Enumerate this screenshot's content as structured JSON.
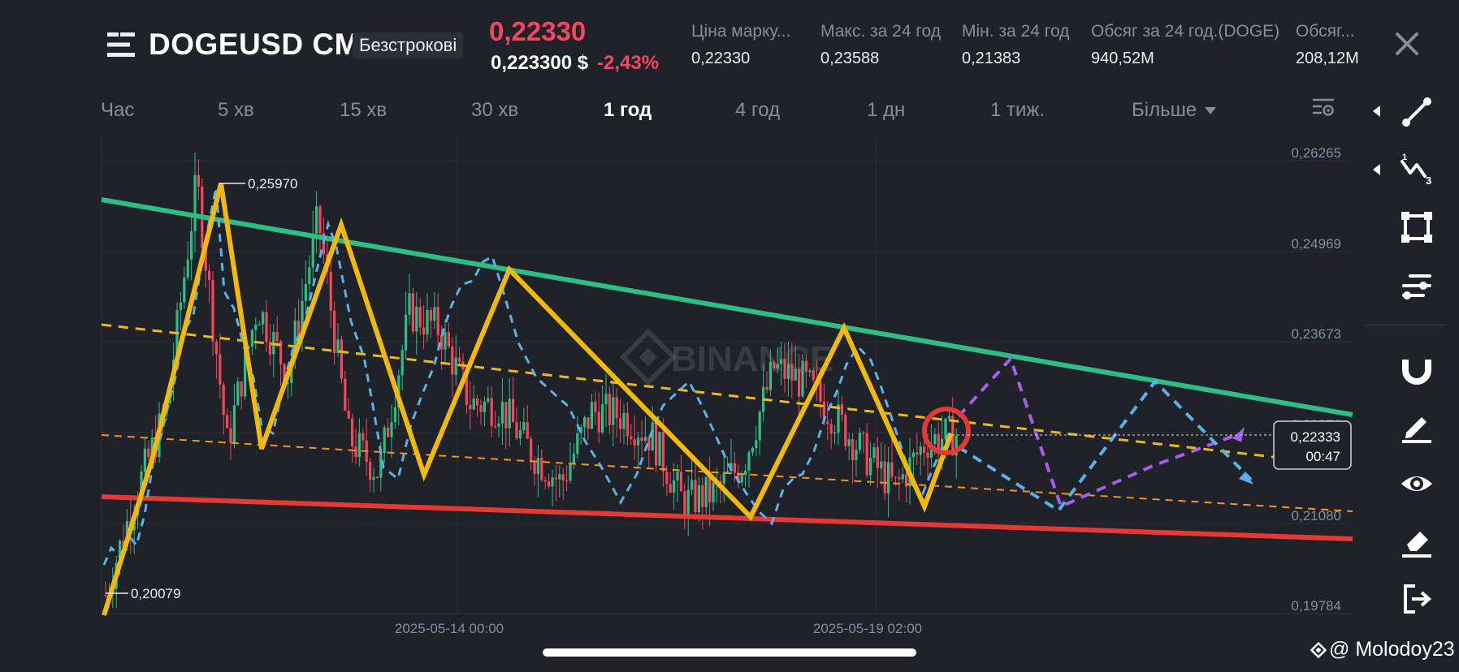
{
  "header": {
    "symbol": "DOGEUSD CM",
    "badge": "Безстрокові",
    "last_price": "0,22330",
    "sub_price": "0,223300 $",
    "change_pct": "-2,43%",
    "stats": [
      {
        "label": "Ціна марку...",
        "value": "0,22330"
      },
      {
        "label": "Макс. за 24 год",
        "value": "0,23588"
      },
      {
        "label": "Мін. за 24 год",
        "value": "0,21383"
      },
      {
        "label": "Обсяг за 24 год.(DOGE)",
        "value": "940,52M"
      },
      {
        "label": "Обсяг...",
        "value": "208,12M"
      }
    ]
  },
  "tabs": [
    {
      "label": "Час",
      "active": false
    },
    {
      "label": "5 хв",
      "active": false
    },
    {
      "label": "15 хв",
      "active": false
    },
    {
      "label": "30 хв",
      "active": false
    },
    {
      "label": "1 год",
      "active": true
    },
    {
      "label": "4 год",
      "active": false
    },
    {
      "label": "1 дн",
      "active": false
    },
    {
      "label": "1 тиж.",
      "active": false
    }
  ],
  "more_label": "Більше",
  "chart": {
    "watermark": "BINANCE",
    "y_ticks": [
      "0,26265",
      "0,24969",
      "0,23673",
      "0,22376",
      "0,21080",
      "0,19784"
    ],
    "x_ticks": [
      "2025-05-14 00:00",
      "2025-05-19 02:00"
    ],
    "high_label": "0,25970",
    "low_label": "0,20079",
    "current_price": "0,22333",
    "countdown": "00:47",
    "colors": {
      "up": "#2ebd85",
      "down": "#f6465d",
      "resistance": "#2ebd85",
      "support": "#e53935",
      "zigzag": "#f0b90b",
      "midline": "#f0b90b",
      "lower_dashed": "#f7931a",
      "projection_blue": "#5ab0e8",
      "projection_purple": "#a55eea",
      "marker_circle": "#e53935"
    }
  },
  "chart_data": {
    "type": "candlestick",
    "symbol": "DOGEUSD CM",
    "interval": "1 год",
    "y_range": [
      0.19784,
      0.26265
    ],
    "y_ticks": [
      0.26265,
      0.24969,
      0.23673,
      0.22376,
      0.2108,
      0.19784
    ],
    "x_ticks": [
      "2025-05-14 00:00",
      "2025-05-19 02:00"
    ],
    "max_marked": 0.2597,
    "min_marked": 0.20079,
    "last_price": 0.22333,
    "price_path": [
      0.2005,
      0.215,
      0.227,
      0.2597,
      0.222,
      0.242,
      0.232,
      0.2545,
      0.223,
      0.218,
      0.241,
      0.2385,
      0.228,
      0.2275,
      0.221,
      0.2165,
      0.2268,
      0.2262,
      0.223,
      0.2138,
      0.215,
      0.2195,
      0.233,
      0.231,
      0.226,
      0.2205,
      0.2158,
      0.2225,
      0.2235
    ],
    "trendlines": [
      {
        "role": "resistance",
        "from": 0.2565,
        "to": 0.2247
      },
      {
        "role": "support",
        "from": 0.2175,
        "to": 0.2078
      }
    ]
  },
  "footer": {
    "watermark_handle": "@ Molodoy23"
  }
}
